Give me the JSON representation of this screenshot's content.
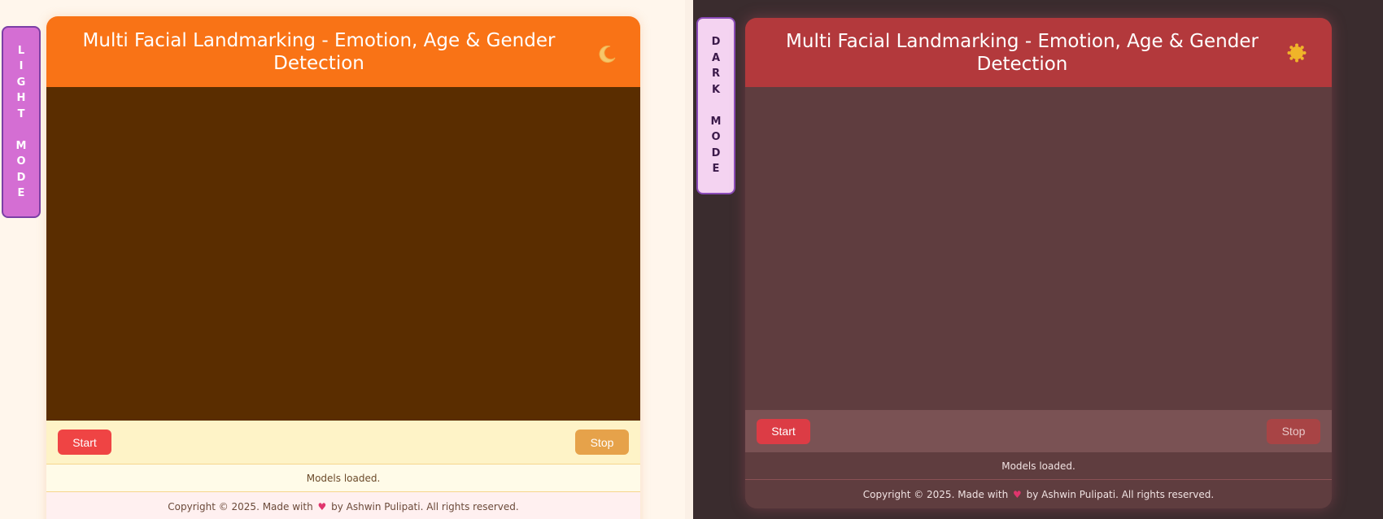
{
  "light": {
    "mode_label": "L\nI\nG\nH\nT\n\nM\nO\nD\nE",
    "title": "Multi Facial Landmarking - Emotion, Age & Gender Detection",
    "theme_icon": "moon-icon",
    "start_label": "Start",
    "stop_label": "Stop",
    "status": "Models loaded.",
    "footer_before": "Copyright © 2025. Made with",
    "footer_after": "by Ashwin Pulipati. All rights reserved.",
    "colors": {
      "header": "#f97316",
      "video": "#5a2d00",
      "start": "#ef4444",
      "stop": "#e6a24a"
    }
  },
  "dark": {
    "mode_label": "D\nA\nR\nK\n\nM\nO\nD\nE",
    "title": "Multi Facial Landmarking - Emotion, Age & Gender Detection",
    "theme_icon": "sun-icon",
    "start_label": "Start",
    "stop_label": "Stop",
    "status": "Models loaded.",
    "footer_before": "Copyright © 2025. Made with",
    "footer_after": "by Ashwin Pulipati. All rights reserved.",
    "colors": {
      "header": "#b3393c",
      "video": "#5f3d3f",
      "start": "#dc3c45",
      "stop": "#a84445"
    }
  },
  "heart_icon": "heart-icon"
}
